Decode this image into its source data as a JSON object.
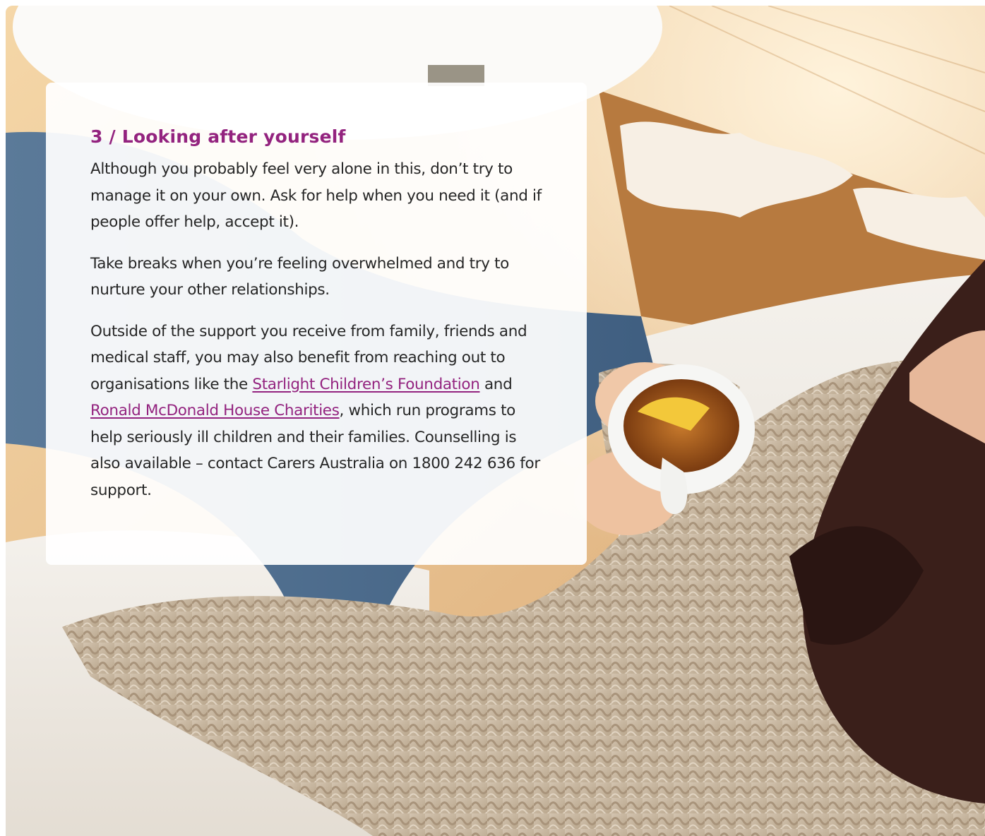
{
  "section": {
    "heading": "3 / Looking after yourself",
    "paragraph1": "Although you probably feel very alone in this, don’t try to manage it on your own. Ask for help when you need it (and if people offer help, accept it).",
    "paragraph2": "Take breaks when you’re feeling overwhelmed and try to nurture your other relationships.",
    "paragraph3": {
      "before_link1": "Outside of the support you receive from family, friends and medical staff, you may also benefit from reaching out to organisations like the ",
      "link1_text": "Starlight Children’s Foundation",
      "between_links": " and ",
      "link2_text": "Ronald McDonald House Charities",
      "after_link2": ", which run programs to help seriously ill children and their families. Counselling is also available – contact Carers Australia on 1800 242 636 for support."
    }
  },
  "colors": {
    "heading": "#93237f",
    "link": "#93237f",
    "body_text": "#262626",
    "card_background": "#ffffff"
  },
  "image": {
    "subject": "woman relaxing on a white sofa in a knit sweater holding a cup of lemon tea"
  }
}
